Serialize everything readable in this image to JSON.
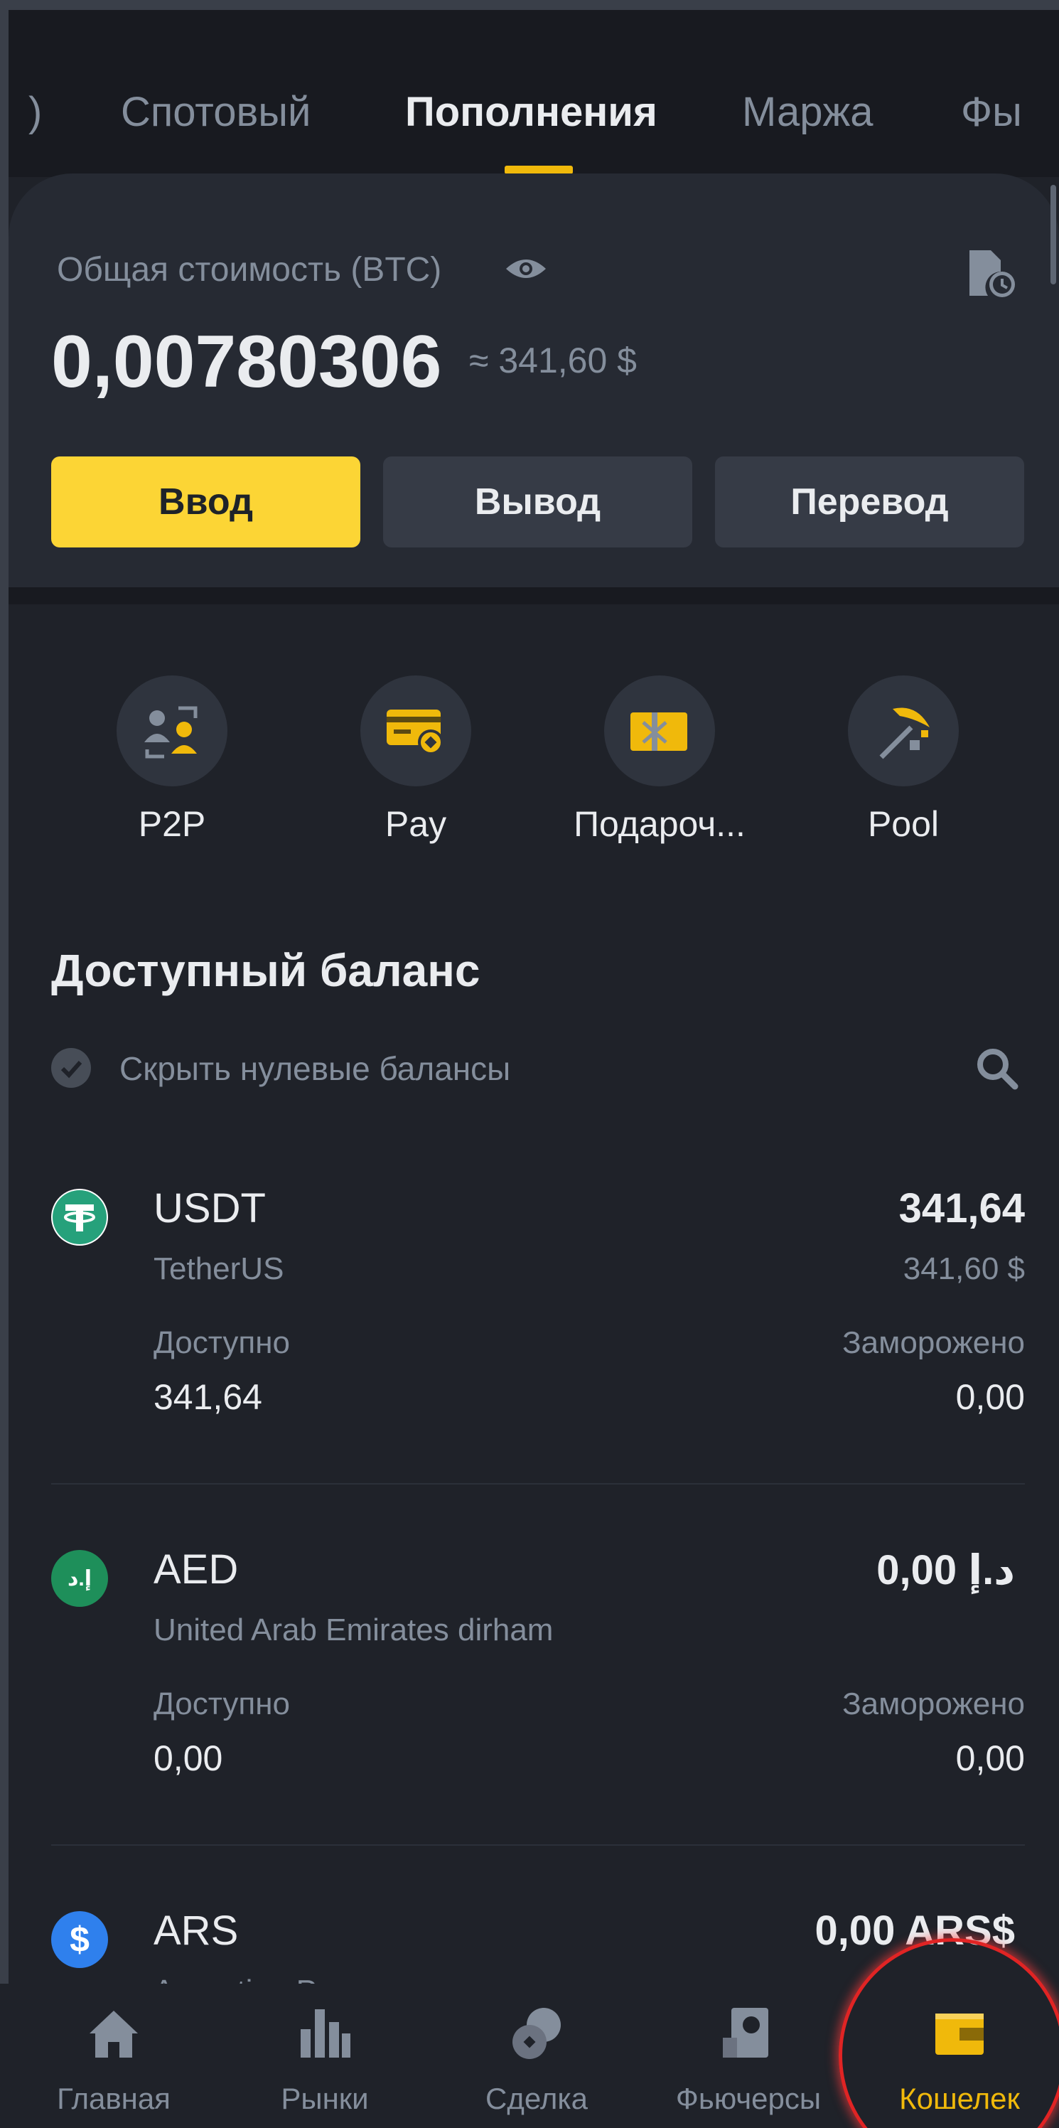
{
  "tabs": [
    {
      "label": "Спотовый"
    },
    {
      "label": "Пополнения"
    },
    {
      "label": "Маржа"
    },
    {
      "label": "Фы"
    }
  ],
  "total": {
    "label": "Общая стоимость (BTC)",
    "value": "0,00780306",
    "usd": "≈ 341,60 $"
  },
  "actions": {
    "deposit": "Ввод",
    "withdraw": "Вывод",
    "transfer": "Перевод"
  },
  "quick_access": [
    {
      "label": "P2P",
      "icon": "p2p-icon"
    },
    {
      "label": "Pay",
      "icon": "pay-card-icon"
    },
    {
      "label": "Подароч...",
      "icon": "gift-card-icon"
    },
    {
      "label": "Pool",
      "icon": "pickaxe-icon"
    }
  ],
  "balance": {
    "title": "Доступный баланс",
    "hide_zero": "Скрыть нулевые балансы"
  },
  "assets": [
    {
      "symbol": "USDT",
      "name": "TetherUS",
      "amount": "341,64",
      "usd": "341,60 $",
      "available_label": "Доступно",
      "available": "341,64",
      "frozen_label": "Заморожено",
      "frozen": "0,00",
      "icon_glyph": "₮",
      "color": "#26a17b"
    },
    {
      "symbol": "AED",
      "name": "United Arab Emirates dirham",
      "amount": "0,00 د.إ",
      "usd": "",
      "available_label": "Доступно",
      "available": "0,00",
      "frozen_label": "Заморожено",
      "frozen": "0,00",
      "icon_glyph": "إ.د",
      "color": "#1e8f5a"
    },
    {
      "symbol": "ARS",
      "name": "Argentine Peso",
      "amount": "0,00 ARS$",
      "icon_glyph": "$",
      "color": "#2f80ed"
    }
  ],
  "nav": [
    {
      "label": "Главная",
      "icon": "home-icon"
    },
    {
      "label": "Рынки",
      "icon": "markets-icon"
    },
    {
      "label": "Сделка",
      "icon": "trade-icon"
    },
    {
      "label": "Фьючерсы",
      "icon": "futures-icon"
    },
    {
      "label": "Кошелек",
      "icon": "wallet-icon"
    }
  ],
  "colors": {
    "accent": "#f0b90b",
    "background": "#1f2229",
    "highlight_ring": "#e02424"
  }
}
